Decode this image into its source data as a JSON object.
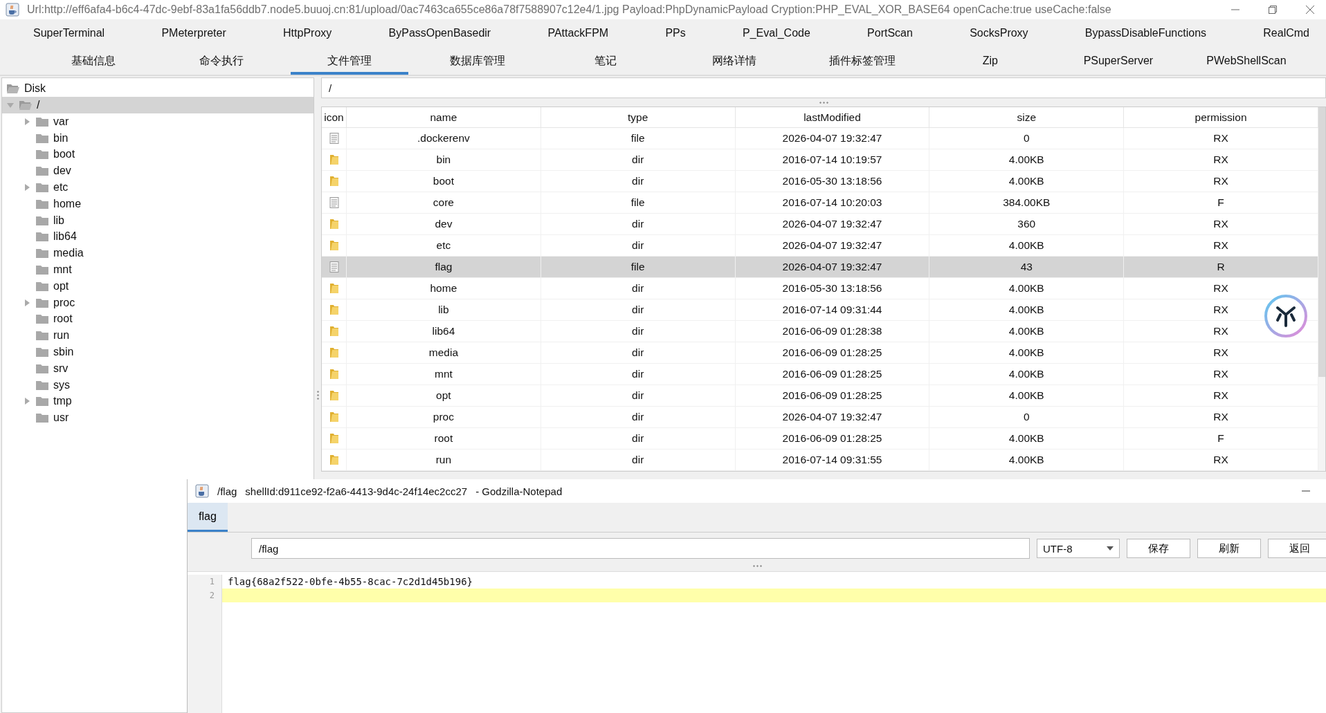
{
  "window": {
    "title": "Url:http://eff6afa4-b6c4-47dc-9ebf-83a1fa56ddb7.node5.buuoj.cn:81/upload/0ac7463ca655ce86a78f7588907c12e4/1.jpg Payload:PhpDynamicPayload Cryption:PHP_EVAL_XOR_BASE64 openCache:true useCache:false"
  },
  "plugin_tabs": [
    "SuperTerminal",
    "PMeterpreter",
    "HttpProxy",
    "ByPassOpenBasedir",
    "PAttackFPM",
    "PPs",
    "P_Eval_Code",
    "PortScan",
    "SocksProxy",
    "BypassDisableFunctions",
    "RealCmd"
  ],
  "tabs": [
    {
      "label": "基础信息",
      "selected": false
    },
    {
      "label": "命令执行",
      "selected": false
    },
    {
      "label": "文件管理",
      "selected": true
    },
    {
      "label": "数据库管理",
      "selected": false
    },
    {
      "label": "笔记",
      "selected": false
    },
    {
      "label": "网络详情",
      "selected": false
    },
    {
      "label": "插件标签管理",
      "selected": false
    },
    {
      "label": "Zip",
      "selected": false
    },
    {
      "label": "PSuperServer",
      "selected": false
    },
    {
      "label": "PWebShellScan",
      "selected": false
    }
  ],
  "tree": {
    "label": "Disk",
    "children": [
      {
        "label": "/",
        "expanded": true,
        "selected": true,
        "children": [
          {
            "label": "var",
            "expandable": true,
            "selected": false
          },
          {
            "label": "bin",
            "expandable": false,
            "selected": false
          },
          {
            "label": "boot",
            "expandable": false,
            "selected": false
          },
          {
            "label": "dev",
            "expandable": false,
            "selected": false
          },
          {
            "label": "etc",
            "expandable": true,
            "selected": false
          },
          {
            "label": "home",
            "expandable": false,
            "selected": false
          },
          {
            "label": "lib",
            "expandable": false,
            "selected": false
          },
          {
            "label": "lib64",
            "expandable": false,
            "selected": false
          },
          {
            "label": "media",
            "expandable": false,
            "selected": false
          },
          {
            "label": "mnt",
            "expandable": false,
            "selected": false
          },
          {
            "label": "opt",
            "expandable": false,
            "selected": false
          },
          {
            "label": "proc",
            "expandable": true,
            "selected": false
          },
          {
            "label": "root",
            "expandable": false,
            "selected": false
          },
          {
            "label": "run",
            "expandable": false,
            "selected": false
          },
          {
            "label": "sbin",
            "expandable": false,
            "selected": false
          },
          {
            "label": "srv",
            "expandable": false,
            "selected": false
          },
          {
            "label": "sys",
            "expandable": false,
            "selected": false
          },
          {
            "label": "tmp",
            "expandable": true,
            "selected": false
          },
          {
            "label": "usr",
            "expandable": false,
            "selected": false
          }
        ]
      }
    ]
  },
  "path_field": {
    "value": "/"
  },
  "table": {
    "columns": [
      "icon",
      "name",
      "type",
      "lastModified",
      "size",
      "permission"
    ],
    "rows": [
      {
        "kind": "file",
        "name": ".dockerenv",
        "type": "file",
        "lastModified": "2026-04-07 19:32:47",
        "size": "0",
        "permission": "RX",
        "selected": false
      },
      {
        "kind": "dir",
        "name": "bin",
        "type": "dir",
        "lastModified": "2016-07-14 10:19:57",
        "size": "4.00KB",
        "permission": "RX",
        "selected": false
      },
      {
        "kind": "dir",
        "name": "boot",
        "type": "dir",
        "lastModified": "2016-05-30 13:18:56",
        "size": "4.00KB",
        "permission": "RX",
        "selected": false
      },
      {
        "kind": "file",
        "name": "core",
        "type": "file",
        "lastModified": "2016-07-14 10:20:03",
        "size": "384.00KB",
        "permission": "F",
        "selected": false
      },
      {
        "kind": "dir",
        "name": "dev",
        "type": "dir",
        "lastModified": "2026-04-07 19:32:47",
        "size": "360",
        "permission": "RX",
        "selected": false
      },
      {
        "kind": "dir",
        "name": "etc",
        "type": "dir",
        "lastModified": "2026-04-07 19:32:47",
        "size": "4.00KB",
        "permission": "RX",
        "selected": false
      },
      {
        "kind": "file",
        "name": "flag",
        "type": "file",
        "lastModified": "2026-04-07 19:32:47",
        "size": "43",
        "permission": "R",
        "selected": true
      },
      {
        "kind": "dir",
        "name": "home",
        "type": "dir",
        "lastModified": "2016-05-30 13:18:56",
        "size": "4.00KB",
        "permission": "RX",
        "selected": false
      },
      {
        "kind": "dir",
        "name": "lib",
        "type": "dir",
        "lastModified": "2016-07-14 09:31:44",
        "size": "4.00KB",
        "permission": "RX",
        "selected": false
      },
      {
        "kind": "dir",
        "name": "lib64",
        "type": "dir",
        "lastModified": "2016-06-09 01:28:38",
        "size": "4.00KB",
        "permission": "RX",
        "selected": false
      },
      {
        "kind": "dir",
        "name": "media",
        "type": "dir",
        "lastModified": "2016-06-09 01:28:25",
        "size": "4.00KB",
        "permission": "RX",
        "selected": false
      },
      {
        "kind": "dir",
        "name": "mnt",
        "type": "dir",
        "lastModified": "2016-06-09 01:28:25",
        "size": "4.00KB",
        "permission": "RX",
        "selected": false
      },
      {
        "kind": "dir",
        "name": "opt",
        "type": "dir",
        "lastModified": "2016-06-09 01:28:25",
        "size": "4.00KB",
        "permission": "RX",
        "selected": false
      },
      {
        "kind": "dir",
        "name": "proc",
        "type": "dir",
        "lastModified": "2026-04-07 19:32:47",
        "size": "0",
        "permission": "RX",
        "selected": false
      },
      {
        "kind": "dir",
        "name": "root",
        "type": "dir",
        "lastModified": "2016-06-09 01:28:25",
        "size": "4.00KB",
        "permission": "F",
        "selected": false
      },
      {
        "kind": "dir",
        "name": "run",
        "type": "dir",
        "lastModified": "2016-07-14 09:31:55",
        "size": "4.00KB",
        "permission": "RX",
        "selected": false
      }
    ]
  },
  "notepad": {
    "title": "/flag",
    "shell_id": "shellId:d911ce92-f2a6-4413-9d4c-24f14ec2cc27",
    "app_name": "- Godzilla-Notepad",
    "tabs": [
      {
        "label": "flag",
        "selected": true
      }
    ],
    "path_field": {
      "value": "/flag"
    },
    "encoding": "UTF-8",
    "buttons": [
      "保存",
      "刷新",
      "返回"
    ],
    "lines": [
      {
        "number": "1",
        "text": "flag{68a2f522-0bfe-4b55-8cac-7c2d1d45b196}",
        "current": false
      },
      {
        "number": "2",
        "current": true
      }
    ]
  }
}
